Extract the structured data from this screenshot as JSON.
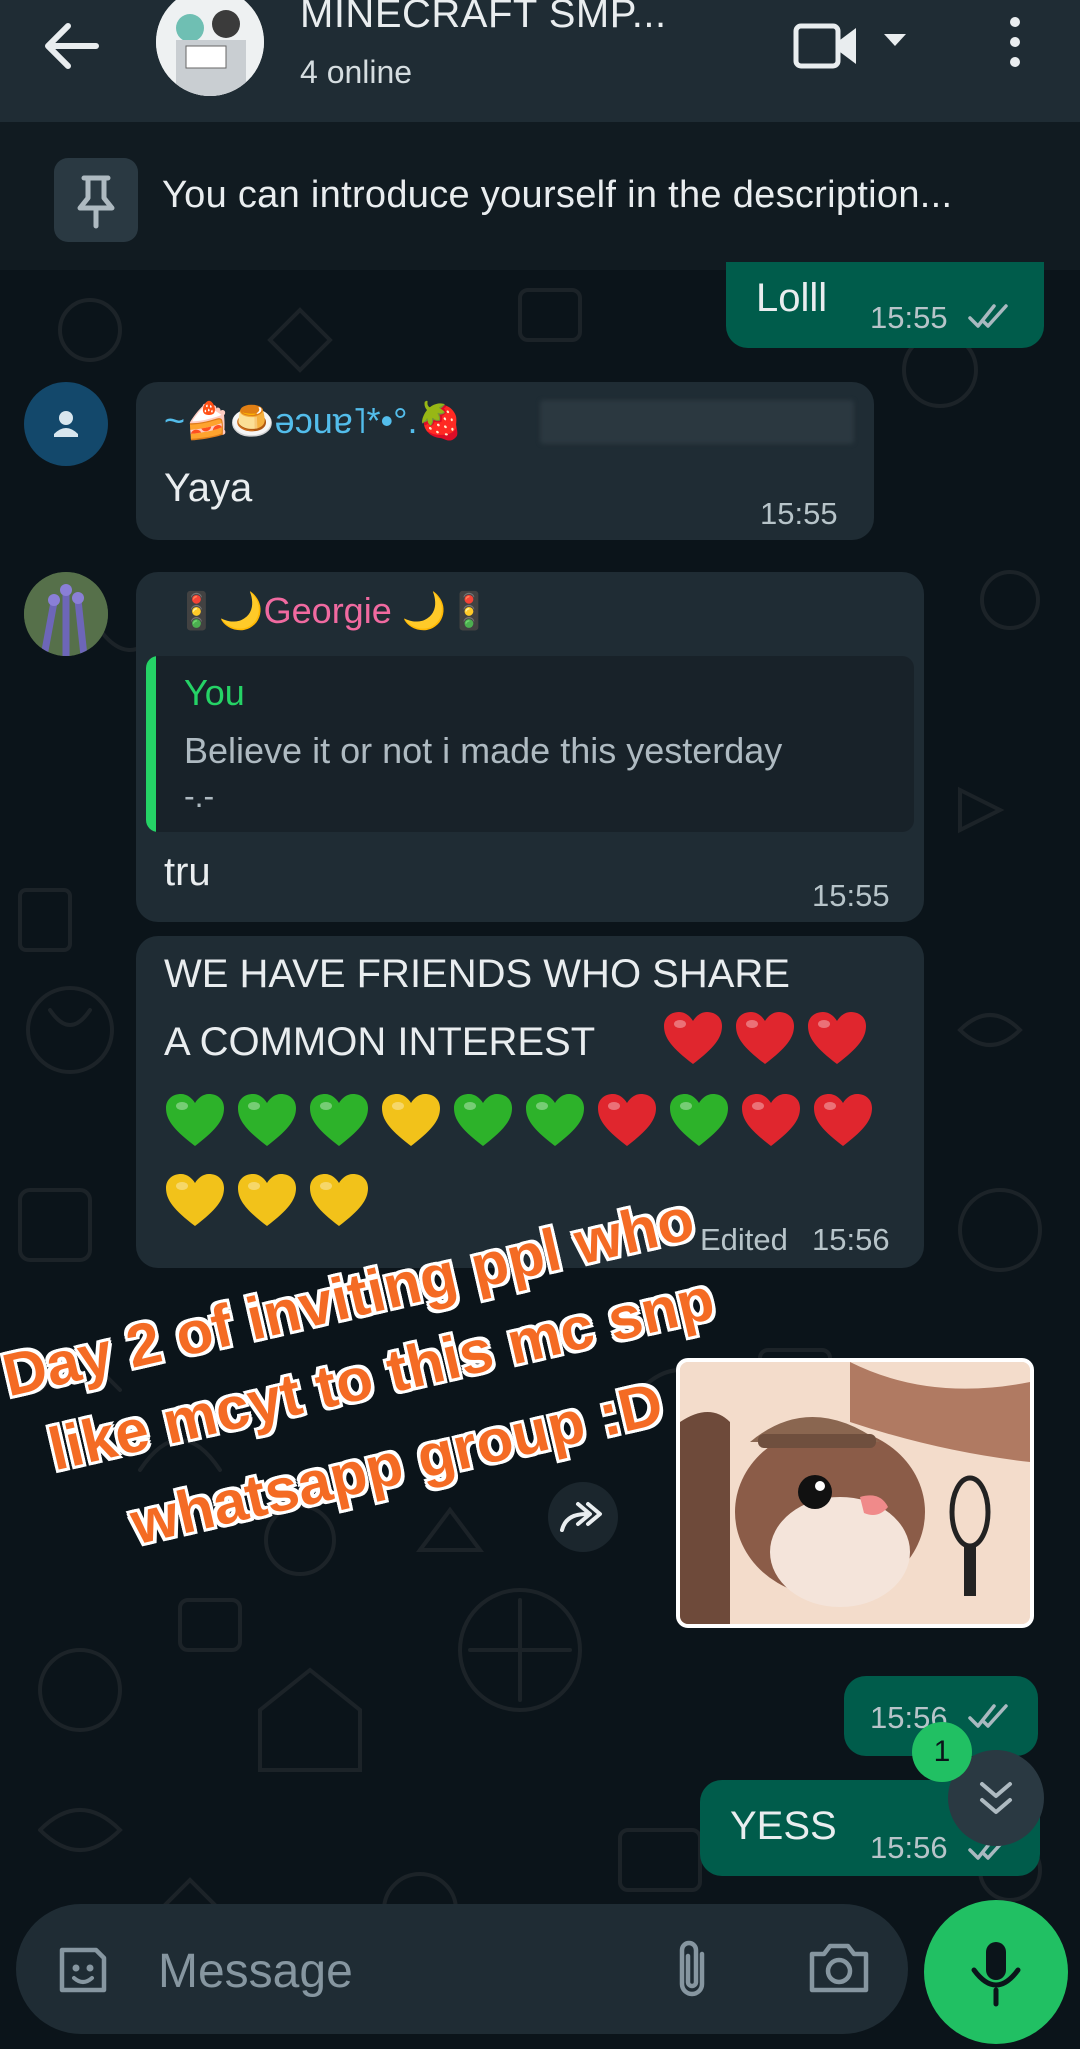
{
  "header": {
    "title": "MINECRAFT SMP...",
    "subtitle": "4 online"
  },
  "pinned": {
    "text": "You can introduce yourself in the description..."
  },
  "messages": [
    {
      "text": "Lolll",
      "time": "15:55",
      "direction": "out"
    },
    {
      "sender": "~🍰🍮ǝɔuɐ˥*•°.🍓",
      "text": "Yaya",
      "time": "15:55",
      "direction": "in"
    },
    {
      "sender": "🚦🌙Georgie 🌙🚦",
      "reply_author": "You",
      "reply_text_1": "Believe it or not i made this yesterday",
      "reply_text_2": "-.-",
      "text": "tru",
      "time": "15:55",
      "direction": "in"
    },
    {
      "line1": "WE HAVE FRIENDS WHO SHARE",
      "line2": "A COMMON INTEREST",
      "edited_label": "Edited",
      "time": "15:56",
      "direction": "in"
    },
    {
      "time": "15:56",
      "direction": "out"
    },
    {
      "text": "YESS",
      "time": "15:56",
      "direction": "out"
    }
  ],
  "caption": {
    "line1": "Day 2 of inviting ppl who",
    "line2": "like mcyt to this mc snp",
    "line3": "whatsapp group :D"
  },
  "unread_badge": "1",
  "composer": {
    "placeholder": "Message"
  },
  "colors": {
    "accent_green": "#21c063",
    "outgoing_bubble": "#005c4b",
    "incoming_bubble": "#1f2c34",
    "sender1_name": "#53bdeb",
    "sender2_name": "#f06aa0",
    "caption_orange": "#f46b24",
    "read_ticks": "#a9b9c0"
  },
  "icons": [
    "back-arrow-icon",
    "video-call-icon",
    "dropdown-caret-icon",
    "more-options-icon",
    "pin-icon",
    "default-user-icon",
    "read-receipt-icon",
    "forward-icon",
    "scroll-down-icon",
    "sticker-icon",
    "attach-icon",
    "camera-icon",
    "mic-icon"
  ]
}
